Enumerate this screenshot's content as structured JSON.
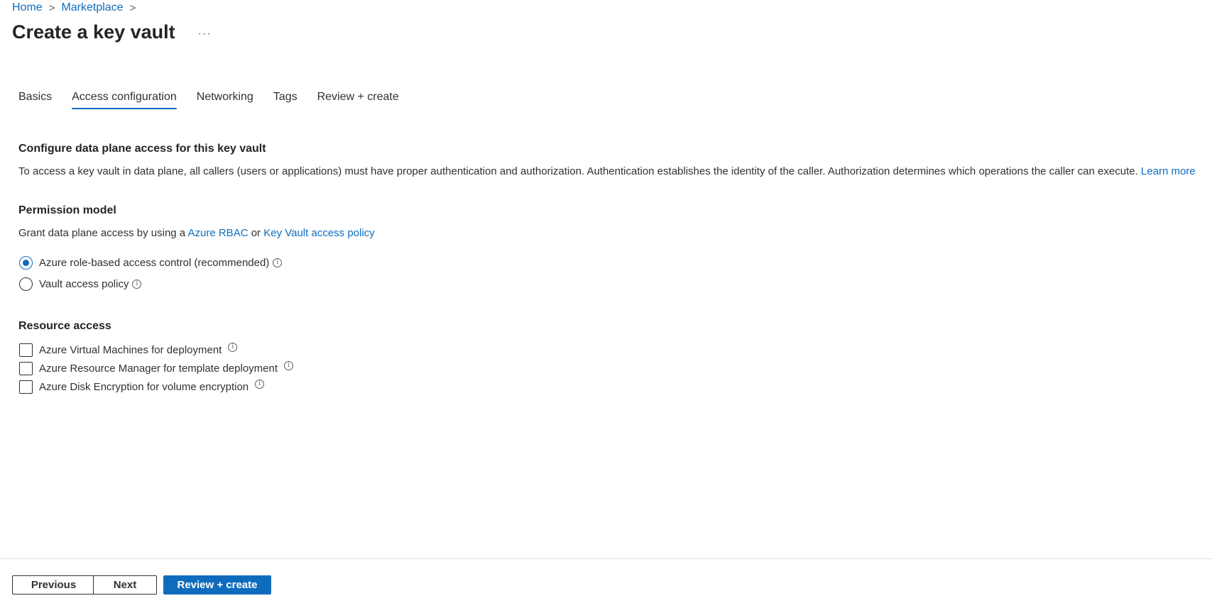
{
  "breadcrumb": {
    "items": [
      "Home",
      "Marketplace"
    ],
    "separator": ">"
  },
  "header": {
    "title": "Create a key vault",
    "more": "···"
  },
  "tabs": [
    {
      "label": "Basics",
      "active": false
    },
    {
      "label": "Access configuration",
      "active": true
    },
    {
      "label": "Networking",
      "active": false
    },
    {
      "label": "Tags",
      "active": false
    },
    {
      "label": "Review + create",
      "active": false
    }
  ],
  "data_plane": {
    "heading": "Configure data plane access for this key vault",
    "description": "To access a key vault in data plane, all callers (users or applications) must have proper authentication and authorization. Authentication establishes the identity of the caller. Authorization determines which operations the caller can execute.",
    "learn_more": "Learn more"
  },
  "permission_model": {
    "heading": "Permission model",
    "desc_prefix": "Grant data plane access by using a",
    "link_rbac": "Azure RBAC",
    "desc_or": "or",
    "link_policy": "Key Vault access policy",
    "options": [
      {
        "label": "Azure role-based access control (recommended)",
        "selected": true
      },
      {
        "label": "Vault access policy",
        "selected": false
      }
    ]
  },
  "resource_access": {
    "heading": "Resource access",
    "options": [
      {
        "label": "Azure Virtual Machines for deployment",
        "checked": false
      },
      {
        "label": "Azure Resource Manager for template deployment",
        "checked": false
      },
      {
        "label": "Azure Disk Encryption for volume encryption",
        "checked": false
      }
    ]
  },
  "footer": {
    "previous": "Previous",
    "next": "Next",
    "review_create": "Review + create"
  },
  "colors": {
    "accent": "#0f6cbd",
    "text": "#323130",
    "divider": "#e1dfdd"
  },
  "icons": {
    "info": "info-icon",
    "chevron": "chevron-right-icon",
    "more": "more-icon"
  }
}
